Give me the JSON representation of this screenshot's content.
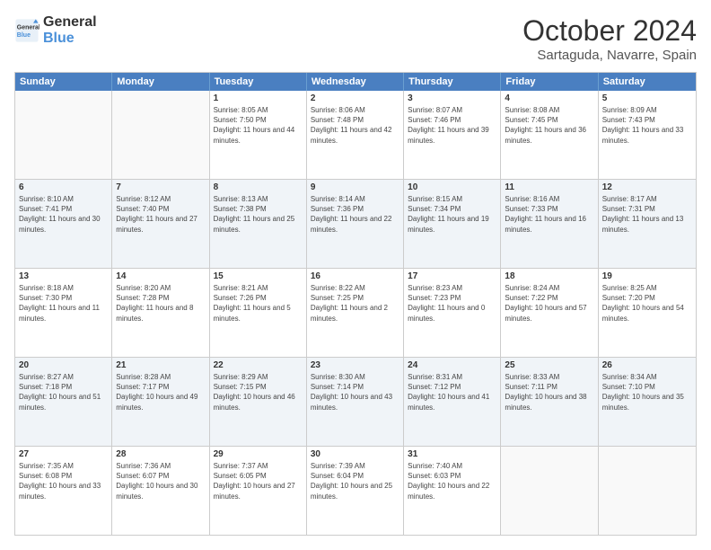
{
  "header": {
    "logo_general": "General",
    "logo_blue": "Blue",
    "month_year": "October 2024",
    "location": "Sartaguda, Navarre, Spain"
  },
  "calendar": {
    "days_of_week": [
      "Sunday",
      "Monday",
      "Tuesday",
      "Wednesday",
      "Thursday",
      "Friday",
      "Saturday"
    ],
    "rows": [
      [
        {
          "day": "",
          "info": "",
          "empty": true
        },
        {
          "day": "",
          "info": "",
          "empty": true
        },
        {
          "day": "1",
          "info": "Sunrise: 8:05 AM\nSunset: 7:50 PM\nDaylight: 11 hours and 44 minutes."
        },
        {
          "day": "2",
          "info": "Sunrise: 8:06 AM\nSunset: 7:48 PM\nDaylight: 11 hours and 42 minutes."
        },
        {
          "day": "3",
          "info": "Sunrise: 8:07 AM\nSunset: 7:46 PM\nDaylight: 11 hours and 39 minutes."
        },
        {
          "day": "4",
          "info": "Sunrise: 8:08 AM\nSunset: 7:45 PM\nDaylight: 11 hours and 36 minutes."
        },
        {
          "day": "5",
          "info": "Sunrise: 8:09 AM\nSunset: 7:43 PM\nDaylight: 11 hours and 33 minutes."
        }
      ],
      [
        {
          "day": "6",
          "info": "Sunrise: 8:10 AM\nSunset: 7:41 PM\nDaylight: 11 hours and 30 minutes."
        },
        {
          "day": "7",
          "info": "Sunrise: 8:12 AM\nSunset: 7:40 PM\nDaylight: 11 hours and 27 minutes."
        },
        {
          "day": "8",
          "info": "Sunrise: 8:13 AM\nSunset: 7:38 PM\nDaylight: 11 hours and 25 minutes."
        },
        {
          "day": "9",
          "info": "Sunrise: 8:14 AM\nSunset: 7:36 PM\nDaylight: 11 hours and 22 minutes."
        },
        {
          "day": "10",
          "info": "Sunrise: 8:15 AM\nSunset: 7:34 PM\nDaylight: 11 hours and 19 minutes."
        },
        {
          "day": "11",
          "info": "Sunrise: 8:16 AM\nSunset: 7:33 PM\nDaylight: 11 hours and 16 minutes."
        },
        {
          "day": "12",
          "info": "Sunrise: 8:17 AM\nSunset: 7:31 PM\nDaylight: 11 hours and 13 minutes."
        }
      ],
      [
        {
          "day": "13",
          "info": "Sunrise: 8:18 AM\nSunset: 7:30 PM\nDaylight: 11 hours and 11 minutes."
        },
        {
          "day": "14",
          "info": "Sunrise: 8:20 AM\nSunset: 7:28 PM\nDaylight: 11 hours and 8 minutes."
        },
        {
          "day": "15",
          "info": "Sunrise: 8:21 AM\nSunset: 7:26 PM\nDaylight: 11 hours and 5 minutes."
        },
        {
          "day": "16",
          "info": "Sunrise: 8:22 AM\nSunset: 7:25 PM\nDaylight: 11 hours and 2 minutes."
        },
        {
          "day": "17",
          "info": "Sunrise: 8:23 AM\nSunset: 7:23 PM\nDaylight: 11 hours and 0 minutes."
        },
        {
          "day": "18",
          "info": "Sunrise: 8:24 AM\nSunset: 7:22 PM\nDaylight: 10 hours and 57 minutes."
        },
        {
          "day": "19",
          "info": "Sunrise: 8:25 AM\nSunset: 7:20 PM\nDaylight: 10 hours and 54 minutes."
        }
      ],
      [
        {
          "day": "20",
          "info": "Sunrise: 8:27 AM\nSunset: 7:18 PM\nDaylight: 10 hours and 51 minutes."
        },
        {
          "day": "21",
          "info": "Sunrise: 8:28 AM\nSunset: 7:17 PM\nDaylight: 10 hours and 49 minutes."
        },
        {
          "day": "22",
          "info": "Sunrise: 8:29 AM\nSunset: 7:15 PM\nDaylight: 10 hours and 46 minutes."
        },
        {
          "day": "23",
          "info": "Sunrise: 8:30 AM\nSunset: 7:14 PM\nDaylight: 10 hours and 43 minutes."
        },
        {
          "day": "24",
          "info": "Sunrise: 8:31 AM\nSunset: 7:12 PM\nDaylight: 10 hours and 41 minutes."
        },
        {
          "day": "25",
          "info": "Sunrise: 8:33 AM\nSunset: 7:11 PM\nDaylight: 10 hours and 38 minutes."
        },
        {
          "day": "26",
          "info": "Sunrise: 8:34 AM\nSunset: 7:10 PM\nDaylight: 10 hours and 35 minutes."
        }
      ],
      [
        {
          "day": "27",
          "info": "Sunrise: 7:35 AM\nSunset: 6:08 PM\nDaylight: 10 hours and 33 minutes."
        },
        {
          "day": "28",
          "info": "Sunrise: 7:36 AM\nSunset: 6:07 PM\nDaylight: 10 hours and 30 minutes."
        },
        {
          "day": "29",
          "info": "Sunrise: 7:37 AM\nSunset: 6:05 PM\nDaylight: 10 hours and 27 minutes."
        },
        {
          "day": "30",
          "info": "Sunrise: 7:39 AM\nSunset: 6:04 PM\nDaylight: 10 hours and 25 minutes."
        },
        {
          "day": "31",
          "info": "Sunrise: 7:40 AM\nSunset: 6:03 PM\nDaylight: 10 hours and 22 minutes."
        },
        {
          "day": "",
          "info": "",
          "empty": true
        },
        {
          "day": "",
          "info": "",
          "empty": true
        }
      ]
    ]
  }
}
